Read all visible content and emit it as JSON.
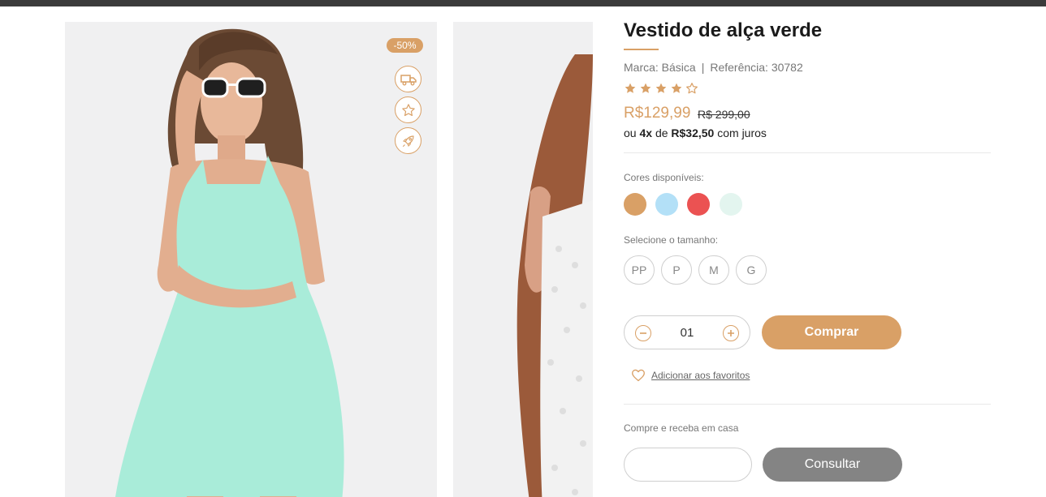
{
  "gallery": {
    "discount_badge": "-50%",
    "side_icons": [
      "truck-icon",
      "star-icon",
      "rocket-icon"
    ]
  },
  "product": {
    "title": "Vestido de alça verde",
    "brand_label": "Marca: Básica",
    "reference_label": "Referência: 30782",
    "rating": 4,
    "rating_max": 5,
    "price": "R$129,99",
    "old_price": "R$ 299,00",
    "installments": {
      "prefix": "ou",
      "count": "4x",
      "mid": "de",
      "amount": "R$32,50",
      "suffix": "com juros"
    }
  },
  "colors": {
    "label": "Cores disponíveis:",
    "options": [
      "#d9a066",
      "#b3e0f7",
      "#eb5252",
      "#e3f5ef"
    ]
  },
  "sizes": {
    "label": "Selecione o tamanho:",
    "options": [
      "PP",
      "P",
      "M",
      "G"
    ]
  },
  "quantity": {
    "value": "01"
  },
  "buy_button": "Comprar",
  "favorite_link": "Adicionar aos favoritos",
  "shipping": {
    "label": "Compre e receba em casa",
    "input_placeholder": "",
    "button": "Consultar"
  },
  "theme": {
    "accent": "#d9a066",
    "button_gray": "#848484"
  }
}
